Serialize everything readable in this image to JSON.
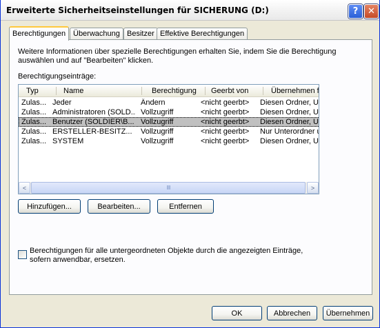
{
  "window": {
    "title": "Erweiterte Sicherheitseinstellungen für SICHERUNG (D:)",
    "help_label": "?",
    "close_label": "✕"
  },
  "tabs": [
    {
      "label": "Berechtigungen",
      "active": true
    },
    {
      "label": "Überwachung",
      "active": false
    },
    {
      "label": "Besitzer",
      "active": false
    },
    {
      "label": "Effektive Berechtigungen",
      "active": false
    }
  ],
  "panel": {
    "info_text": "Weitere Informationen über spezielle Berechtigungen erhalten Sie, indem Sie die Berechtigung auswählen und auf \"Bearbeiten\" klicken.",
    "entries_label": "Berechtigungseinträge:"
  },
  "listview": {
    "columns": [
      "Typ",
      "Name",
      "Berechtigung",
      "Geerbt von",
      "Übernehmen für"
    ],
    "rows": [
      [
        "Zulas...",
        "Jeder",
        "Ändern",
        "<nicht geerbt>",
        "Diesen Ordner, Ur"
      ],
      [
        "Zulas...",
        "Administratoren (SOLD...",
        "Vollzugriff",
        "<nicht geerbt>",
        "Diesen Ordner, Ur"
      ],
      [
        "Zulas...",
        "Benutzer (SOLDIER\\B...",
        "Vollzugriff",
        "<nicht geerbt>",
        "Diesen Ordner, Ur"
      ],
      [
        "Zulas...",
        "ERSTELLER-BESITZ...",
        "Vollzugriff",
        "<nicht geerbt>",
        "Nur Unterordner u"
      ],
      [
        "Zulas...",
        "SYSTEM",
        "Vollzugriff",
        "<nicht geerbt>",
        "Diesen Ordner, Ur"
      ]
    ],
    "selected_row": 2,
    "scroll_left": "<",
    "scroll_right": ">",
    "scroll_grip": "IIII"
  },
  "buttons": {
    "add": "Hinzufügen...",
    "edit": "Bearbeiten...",
    "remove": "Entfernen",
    "ok": "OK",
    "cancel": "Abbrechen",
    "apply": "Übernehmen"
  },
  "checkbox": {
    "label": "Berechtigungen für alle untergeordneten Objekte durch die angezeigten Einträge, sofern anwendbar, ersetzen.",
    "checked": false
  }
}
